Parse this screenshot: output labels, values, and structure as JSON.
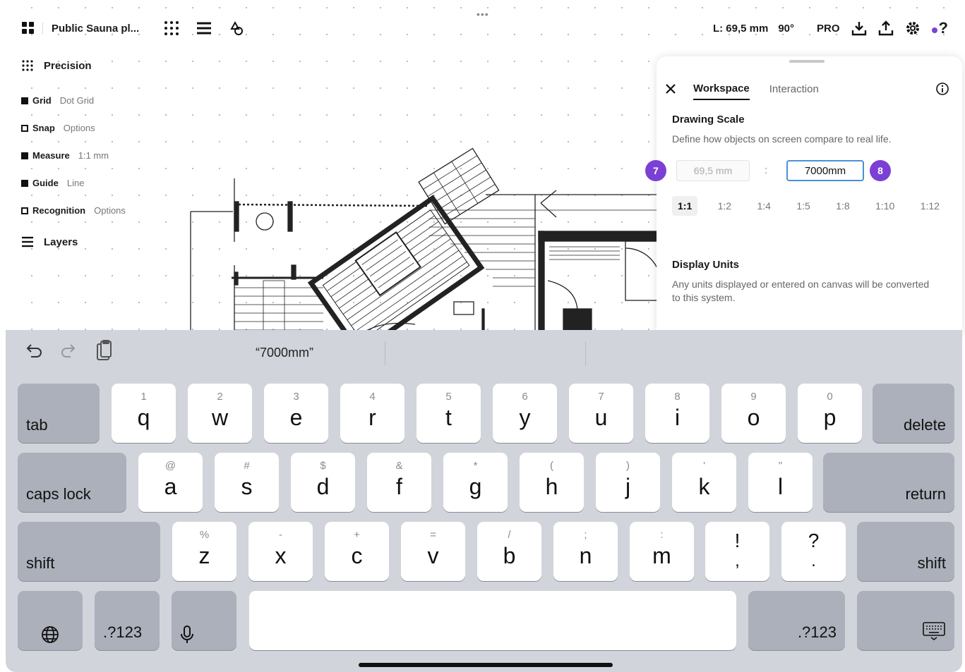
{
  "top_bar": {
    "doc_title": "Public Sauna pl...",
    "overflow_dots": "•••",
    "length_readout": "L: 69,5 mm",
    "angle_readout": "90°",
    "pro_label": "PRO",
    "help_label": "?"
  },
  "precision": {
    "header": "Precision",
    "items": [
      {
        "label": "Grid",
        "value": "Dot Grid",
        "filled": true
      },
      {
        "label": "Snap",
        "value": "Options",
        "filled": false
      },
      {
        "label": "Measure",
        "value": "1:1 mm",
        "filled": true
      },
      {
        "label": "Guide",
        "value": "Line",
        "filled": true
      },
      {
        "label": "Recognition",
        "value": "Options",
        "filled": false
      }
    ],
    "layers_label": "Layers"
  },
  "settings": {
    "tabs": [
      "Workspace",
      "Interaction"
    ],
    "active_tab": "Workspace",
    "scale_heading": "Drawing Scale",
    "scale_desc": "Define how objects on screen compare to real life.",
    "step_a": "7",
    "step_b": "8",
    "real_value": "69,5 mm",
    "colon": ":",
    "scale_input_value": "7000mm",
    "ratios": [
      "1:1",
      "1:2",
      "1:4",
      "1:5",
      "1:8",
      "1:10",
      "1:12"
    ],
    "selected_ratio": "1:1",
    "units_heading": "Display Units",
    "units_desc": "Any units displayed or entered on canvas will be converted to this system."
  },
  "keyboard": {
    "suggestion": "“7000mm”",
    "row1": [
      {
        "k": "q",
        "a": "1"
      },
      {
        "k": "w",
        "a": "2"
      },
      {
        "k": "e",
        "a": "3"
      },
      {
        "k": "r",
        "a": "4"
      },
      {
        "k": "t",
        "a": "5"
      },
      {
        "k": "y",
        "a": "6"
      },
      {
        "k": "u",
        "a": "7"
      },
      {
        "k": "i",
        "a": "8"
      },
      {
        "k": "o",
        "a": "9"
      },
      {
        "k": "p",
        "a": "0"
      }
    ],
    "row2": [
      {
        "k": "a",
        "a": "@"
      },
      {
        "k": "s",
        "a": "#"
      },
      {
        "k": "d",
        "a": "$"
      },
      {
        "k": "f",
        "a": "&"
      },
      {
        "k": "g",
        "a": "*"
      },
      {
        "k": "h",
        "a": "("
      },
      {
        "k": "j",
        "a": ")"
      },
      {
        "k": "k",
        "a": "'"
      },
      {
        "k": "l",
        "a": "\""
      }
    ],
    "row3": [
      {
        "k": "z",
        "a": "%"
      },
      {
        "k": "x",
        "a": "-"
      },
      {
        "k": "c",
        "a": "+"
      },
      {
        "k": "v",
        "a": "="
      },
      {
        "k": "b",
        "a": "/"
      },
      {
        "k": "n",
        "a": ";"
      },
      {
        "k": "m",
        "a": ":"
      }
    ],
    "excl": {
      "top": "!",
      "bottom": ","
    },
    "ques": {
      "top": "?",
      "bottom": "."
    },
    "tab": "tab",
    "delete": "delete",
    "caps_lock": "caps lock",
    "return": "return",
    "shift_left": "shift",
    "shift_right": "shift",
    "num_left": ".?123",
    "num_right": ".?123"
  },
  "colors": {
    "accent": "#7b3fd6",
    "focus": "#4a90d9"
  }
}
